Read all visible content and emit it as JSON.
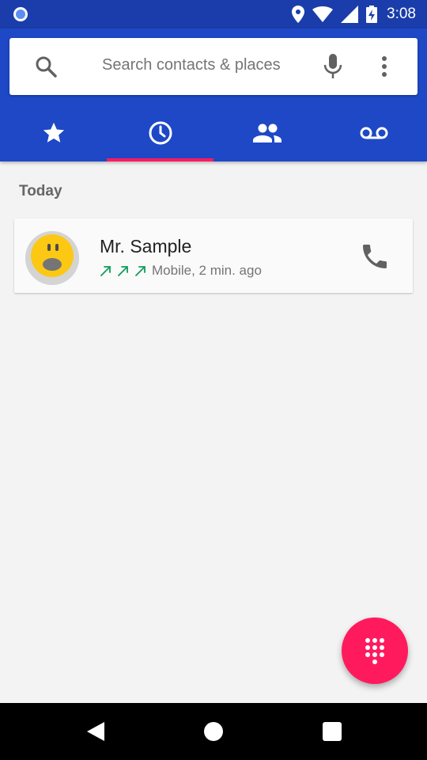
{
  "status_bar": {
    "time": "3:08",
    "icons": [
      "notification-circle-icon",
      "location-icon",
      "wifi-icon",
      "signal-icon",
      "battery-charging-icon"
    ]
  },
  "search": {
    "placeholder": "Search contacts & places",
    "icons": [
      "search-icon",
      "mic-icon",
      "more-vert-icon"
    ]
  },
  "tabs": [
    {
      "icon": "star-icon",
      "name": "Speed dial",
      "selected": false
    },
    {
      "icon": "clock-icon",
      "name": "Recents",
      "selected": true
    },
    {
      "icon": "people-icon",
      "name": "Contacts",
      "selected": false
    },
    {
      "icon": "voicemail-icon",
      "name": "Voicemail",
      "selected": false
    }
  ],
  "recents": {
    "section_label": "Today",
    "items": [
      {
        "name": "Mr. Sample",
        "detail": "Mobile, 2 min. ago",
        "call_type_icons": [
          "outgoing-call-icon",
          "outgoing-call-icon",
          "outgoing-call-icon"
        ],
        "avatar": "surprised-face-avatar"
      }
    ]
  },
  "fab": {
    "icon": "dialpad-icon"
  },
  "nav": {
    "icons": [
      "back-icon",
      "home-icon",
      "recents-icon"
    ]
  },
  "colors": {
    "primary": "#1e48c6",
    "status_bar": "#1a3dab",
    "accent": "#ff1a5e",
    "outgoing_arrow": "#0f9d58",
    "background": "#f3f3f3"
  }
}
